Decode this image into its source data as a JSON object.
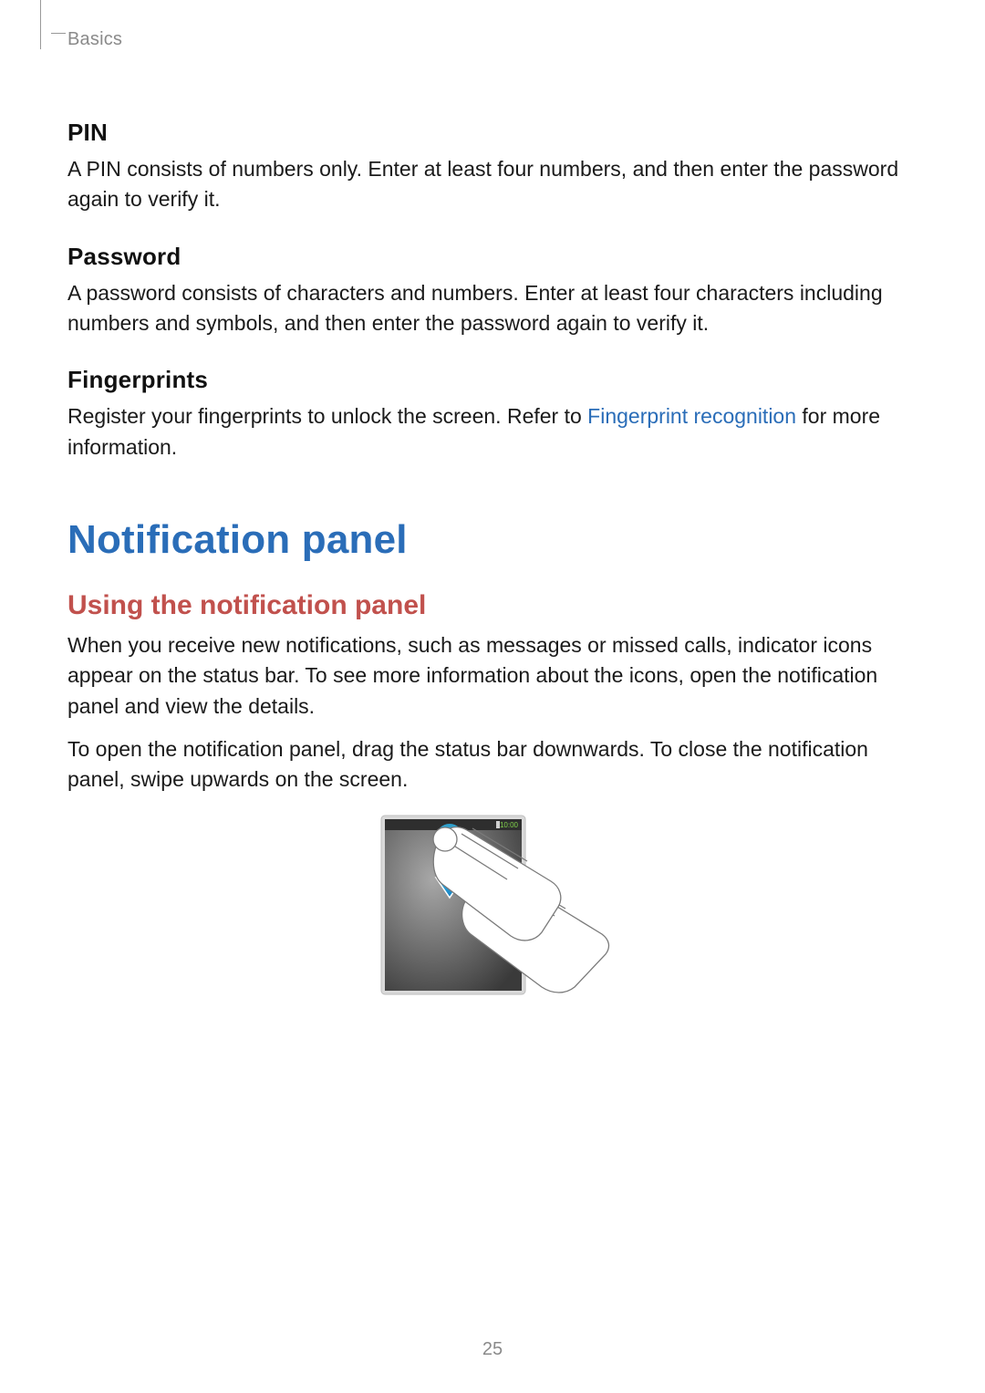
{
  "header": {
    "breadcrumb": "Basics"
  },
  "sections": {
    "pin": {
      "heading": "PIN",
      "body": "A PIN consists of numbers only. Enter at least four numbers, and then enter the password again to verify it."
    },
    "password": {
      "heading": "Password",
      "body": "A password consists of characters and numbers. Enter at least four characters including numbers and symbols, and then enter the password again to verify it."
    },
    "fingerprints": {
      "heading": "Fingerprints",
      "body_pre": "Register your fingerprints to unlock the screen. Refer to ",
      "link": "Fingerprint recognition",
      "body_post": " for more information."
    }
  },
  "main": {
    "title": "Notification panel",
    "subheading": "Using the notification panel",
    "p1": "When you receive new notifications, such as messages or missed calls, indicator icons appear on the status bar. To see more information about the icons, open the notification panel and view the details.",
    "p2": "To open the notification panel, drag the status bar downwards. To close the notification panel, swipe upwards on the screen."
  },
  "figure": {
    "alt": "Drag the status bar downwards to open the notification panel",
    "status_time": "10:00"
  },
  "page_number": "25",
  "colors": {
    "link": "#2a6db8",
    "title": "#2a6db8",
    "subheading": "#c1514d"
  }
}
